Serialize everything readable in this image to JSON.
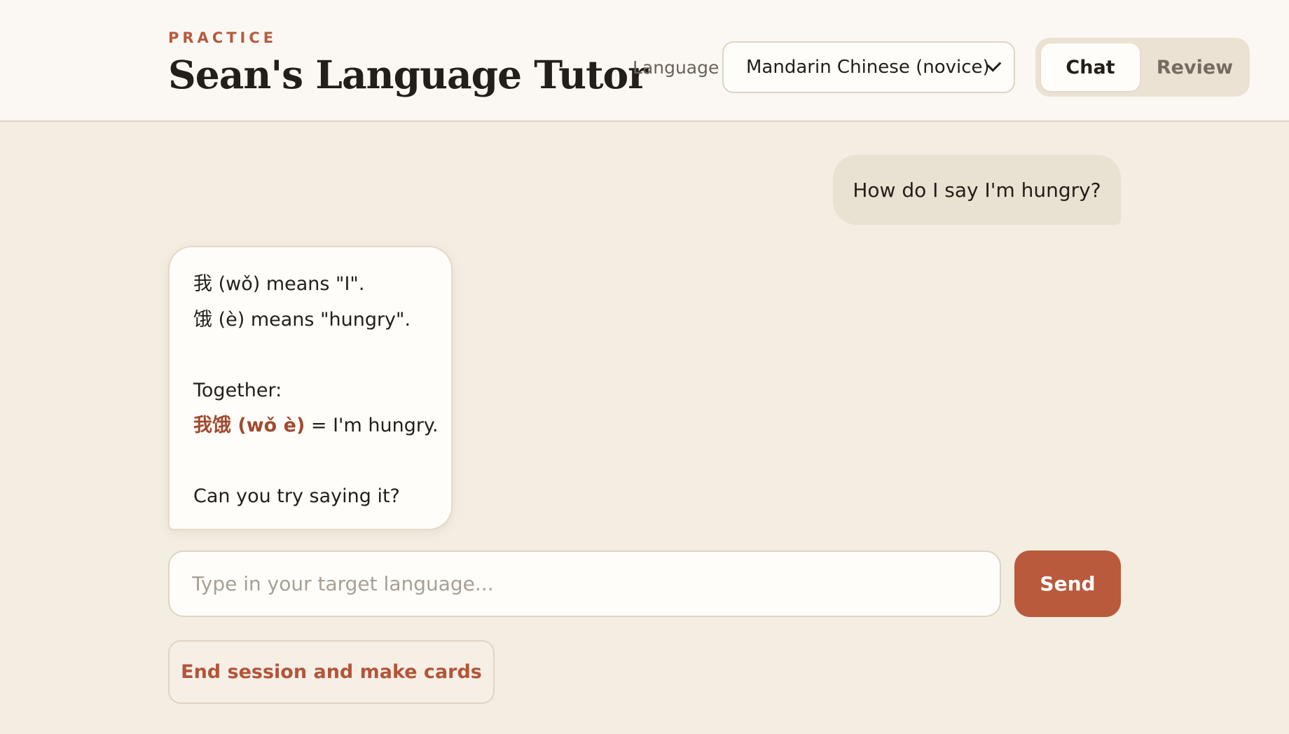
{
  "header": {
    "eyebrow": "PRACTICE",
    "title": "Sean's Language Tutor",
    "language_label": "Language",
    "language_selected": "Mandarin Chinese (novice)",
    "tabs": [
      {
        "label": "Chat",
        "active": true
      },
      {
        "label": "Review",
        "active": false
      }
    ]
  },
  "chat": {
    "messages": [
      {
        "role": "user",
        "text": "How do I say I'm hungry?"
      },
      {
        "role": "assistant",
        "lines": [
          "我 (wǒ) means \"I\".",
          "饿 (è) means \"hungry\".",
          "",
          "Together:",
          {
            "highlight": "我饿 (wǒ è)",
            "rest": " = I'm hungry."
          },
          "",
          "Can you try saying it?"
        ]
      }
    ]
  },
  "composer": {
    "placeholder": "Type in your target language...",
    "value": "",
    "send_label": "Send",
    "end_session_label": "End session and make cards"
  },
  "colors": {
    "accent": "#b95a3c",
    "page_background": "#f4ede2",
    "header_background": "#fbf8f3",
    "user_bubble": "#e9e1d2",
    "assistant_bubble": "#fffdf9"
  }
}
